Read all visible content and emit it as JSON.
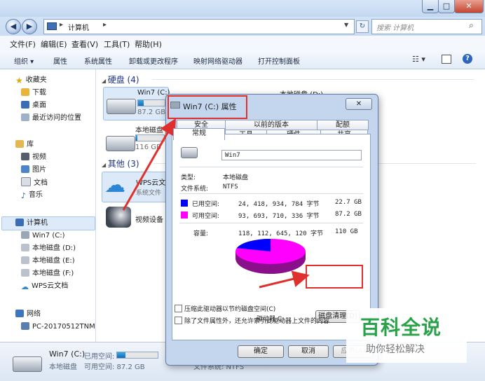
{
  "address": {
    "path": "计算机",
    "search_placeholder": "搜索 计算机"
  },
  "menu": [
    "文件(F)",
    "编辑(E)",
    "查看(V)",
    "工具(T)",
    "帮助(H)"
  ],
  "toolbar": [
    "组织 ▾",
    "属性",
    "系统属性",
    "卸载或更改程序",
    "映射网络驱动器",
    "打开控制面板"
  ],
  "nav": {
    "favorites": "收藏夹",
    "downloads": "下载",
    "desktop": "桌面",
    "recent": "最近访问的位置",
    "libraries": "库",
    "videos": "视频",
    "pictures": "图片",
    "docs": "文档",
    "music": "音乐",
    "computer": "计算机",
    "c": "Win7 (C:)",
    "d": "本地磁盘 (D:)",
    "e": "本地磁盘 (E:)",
    "f": "本地磁盘 (F:)",
    "wps": "WPS云文档",
    "network": "网络",
    "pc": "PC-20170512TNM"
  },
  "content": {
    "hdd_group": "硬盘 (4)",
    "c_name": "Win7 (C:)",
    "c_free": "87.2 GB",
    "d_name": "本地磁盘 (D:)",
    "local_disk": "本地磁盘",
    "local_free": "116 GB",
    "other_group": "其他 (3)",
    "wps_name": "WPS云文",
    "wps_sub": "系统文件",
    "video_device": "视频设备",
    "c_fill": 0.21,
    "local_fill": 0.05
  },
  "details": {
    "name": "Win7 (C:)",
    "used_label": "已用空间:",
    "type": "本地磁盘",
    "free_label": "可用空间: 87.2 GB",
    "fs": "文件系统: NTFS",
    "used_fill": 0.21
  },
  "dialog": {
    "title": "Win7 (C:) 属性",
    "tabs_row1": [
      "安全",
      "以前的版本",
      "配额"
    ],
    "tabs_row2": [
      "常规",
      "工具",
      "硬件",
      "共享"
    ],
    "name_value": "Win7",
    "type_label": "类型:",
    "type_value": "本地磁盘",
    "fs_label": "文件系统:",
    "fs_value": "NTFS",
    "used_label": "已用空间:",
    "used_bytes": "24, 418, 934, 784 字节",
    "used_gb": "22.7 GB",
    "free_label": "可用空间:",
    "free_bytes": "93, 693, 710, 336 字节",
    "free_gb": "87.2 GB",
    "cap_label": "容量:",
    "cap_bytes": "118, 112, 645, 120 字节",
    "cap_gb": "110 GB",
    "drive_label": "驱动器 C:",
    "cleanup_label": "磁盘清理(D)",
    "compress_label": "压缩此驱动器以节约磁盘空间(C)",
    "index_label": "除了文件属性外，还允许索引此驱动器上文件的内容",
    "ok": "确定",
    "cancel": "取消",
    "apply": "应用(A)",
    "used_color": "#0000ff",
    "free_color": "#ff00ff",
    "used_fraction": 0.2067
  },
  "watermark": {
    "title": "百科全说",
    "subtitle": "助你轻松解决"
  }
}
